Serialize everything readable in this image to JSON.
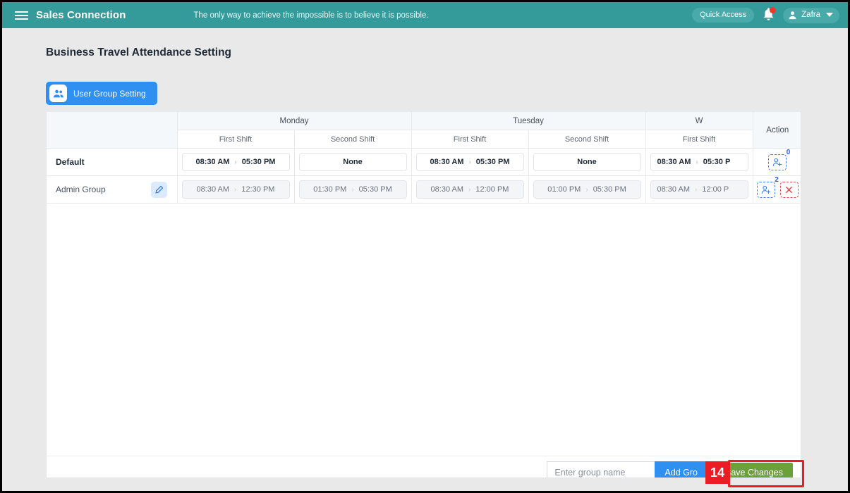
{
  "topbar": {
    "menu_icon": "hamburger-icon",
    "brand": "Sales Connection",
    "tagline": "The only way to achieve the impossible is to believe it is possible.",
    "quick_access": "Quick Access",
    "bell_icon": "notification-bell-icon",
    "user_name": "Zafra",
    "user_icon": "user-avatar-icon",
    "chevron_icon": "chevron-down-icon"
  },
  "page": {
    "title": "Business Travel Attendance Setting",
    "user_group_setting_button": "User Group Setting",
    "user_group_icon": "user-group-icon"
  },
  "table": {
    "row_header_label": "",
    "action_header": "Action",
    "day_headers": [
      "Monday",
      "Tuesday",
      "W"
    ],
    "shift_headers": [
      "First Shift",
      "Second Shift",
      "First Shift",
      "Second Shift",
      "First Shift"
    ],
    "rows": [
      {
        "name": "Default",
        "bold": true,
        "editable": false,
        "edit_icon": "",
        "cells": [
          {
            "start": "08:30 AM",
            "end": "05:30 PM",
            "none": false
          },
          {
            "start": "",
            "end": "",
            "none": true,
            "none_label": "None"
          },
          {
            "start": "08:30 AM",
            "end": "05:30 PM",
            "none": false
          },
          {
            "start": "",
            "end": "",
            "none": true,
            "none_label": "None"
          },
          {
            "start": "08:30 AM",
            "end": "05:30 P",
            "none": false
          }
        ],
        "add_count": "0",
        "add_icon": "add-user-icon",
        "deletable": false
      },
      {
        "name": "Admin Group",
        "bold": false,
        "editable": true,
        "edit_icon": "pencil-edit-icon",
        "cells": [
          {
            "start": "08:30 AM",
            "end": "12:30 PM",
            "none": false
          },
          {
            "start": "01:30 PM",
            "end": "05:30 PM",
            "none": false
          },
          {
            "start": "08:30 AM",
            "end": "12:00 PM",
            "none": false
          },
          {
            "start": "01:00 PM",
            "end": "05:30 PM",
            "none": false
          },
          {
            "start": "08:30 AM",
            "end": "12:00 P",
            "none": false
          }
        ],
        "add_count": "2",
        "add_icon": "add-user-icon",
        "deletable": true,
        "delete_icon": "close-x-icon"
      }
    ],
    "arrow_glyph": "›"
  },
  "footer": {
    "group_input_value": "",
    "group_input_placeholder": "Enter group name",
    "add_group_button": "Add Gro",
    "save_changes_button": "Save Changes"
  },
  "annotation": {
    "step_number": "14"
  },
  "colors": {
    "topbar_teal": "#359a9a",
    "primary_blue": "#2f90f2",
    "save_green": "#6ba03b",
    "annotation_red": "#ec1c24",
    "delete_red": "#ef4444",
    "page_bg": "#e9e9e9"
  }
}
